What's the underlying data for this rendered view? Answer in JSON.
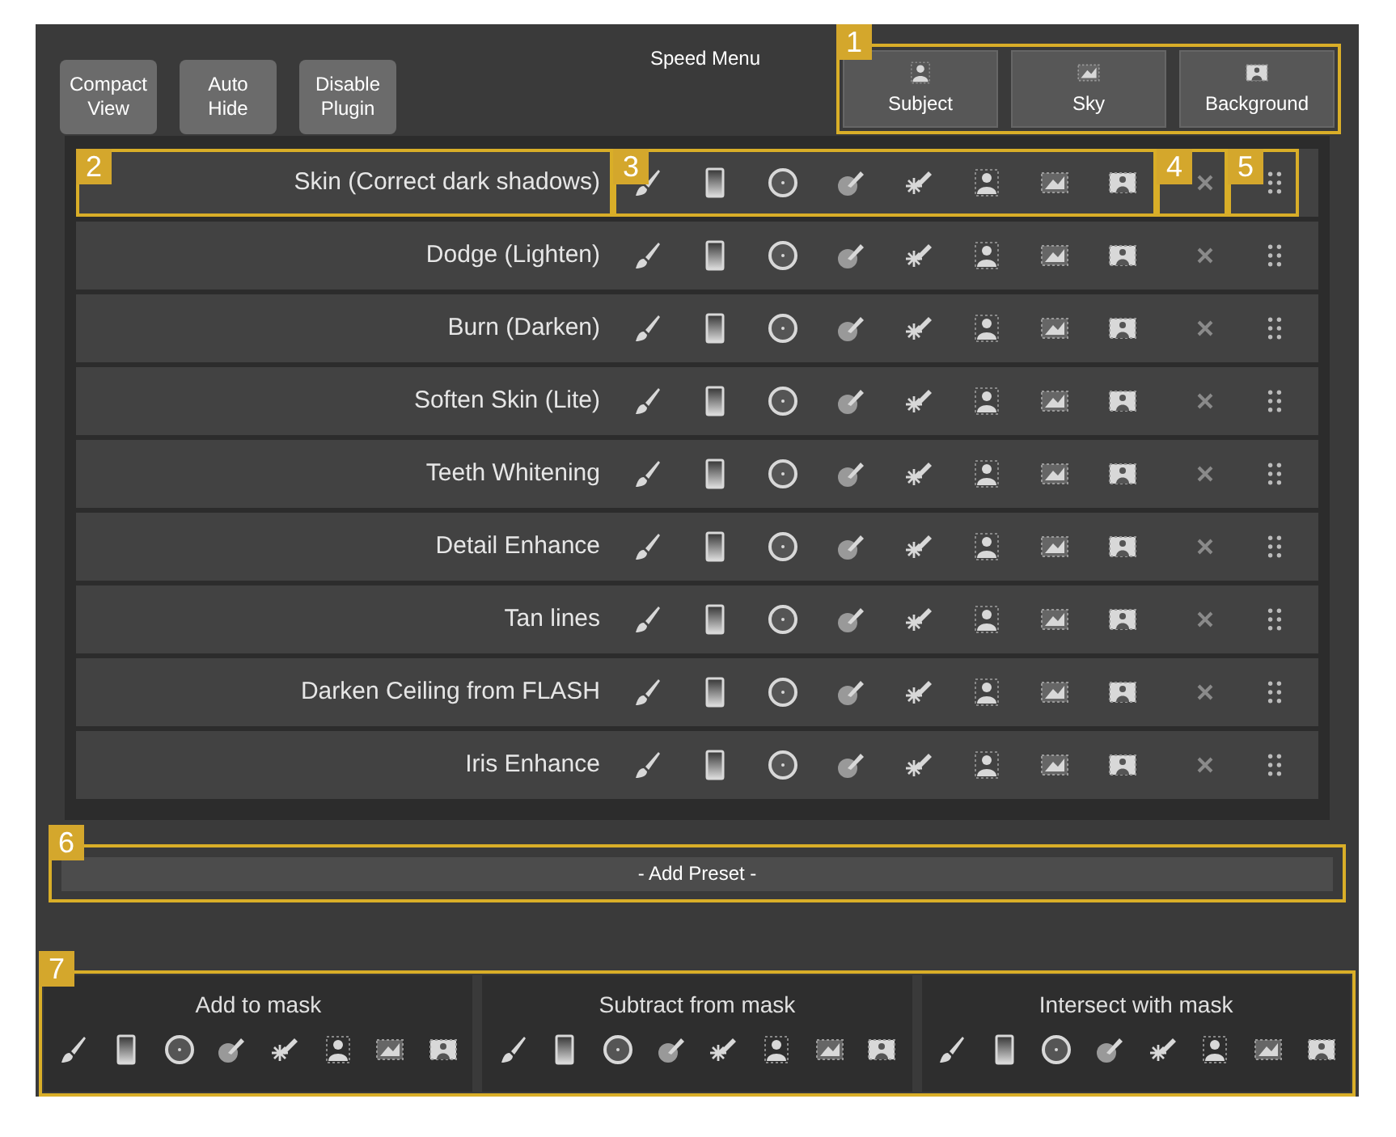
{
  "title": "Speed Menu",
  "top_buttons": [
    {
      "label": "Compact\nView"
    },
    {
      "label": "Auto\nHide"
    },
    {
      "label": "Disable\nPlugin"
    }
  ],
  "mask_targets": {
    "callout": "1",
    "items": [
      {
        "kind": "subject",
        "label": "Subject"
      },
      {
        "kind": "sky",
        "label": "Sky"
      },
      {
        "kind": "background",
        "label": "Background"
      }
    ]
  },
  "presets": [
    {
      "name": "Skin (Correct dark shadows)",
      "name_callout": "2",
      "tools_callout": "3",
      "delete_callout": "4",
      "handle_callout": "5"
    },
    {
      "name": "Dodge (Lighten)"
    },
    {
      "name": "Burn (Darken)"
    },
    {
      "name": "Soften Skin (Lite)"
    },
    {
      "name": "Teeth Whitening"
    },
    {
      "name": "Detail Enhance"
    },
    {
      "name": "Tan lines"
    },
    {
      "name": "Darken Ceiling from FLASH"
    },
    {
      "name": "Iris Enhance"
    }
  ],
  "add_preset": {
    "label": "- Add Preset -",
    "callout": "6"
  },
  "mask_modes": {
    "callout": "7",
    "items": [
      {
        "label": "Add to mask"
      },
      {
        "label": "Subtract from mask"
      },
      {
        "label": "Intersect with mask"
      }
    ]
  }
}
